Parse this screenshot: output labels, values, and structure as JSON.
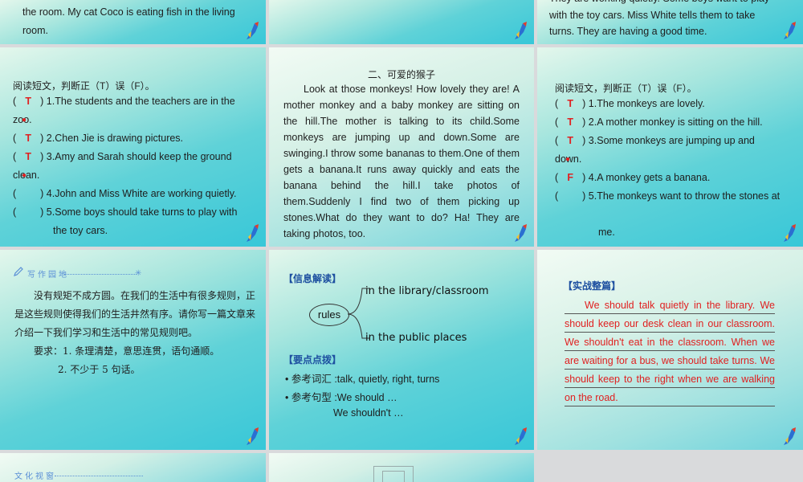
{
  "slide_r1c1": {
    "lines": [
      "the room. My cat Coco is eating fish in the living",
      "room."
    ]
  },
  "slide_r1c3": {
    "lines": [
      "They are working quietly. Some boys want to play",
      "with the toy cars. Miss White tells them to take",
      "turns. They are having a good time."
    ]
  },
  "quiz1": {
    "heading": "阅读短文，判断正（T）误（F）。",
    "items": [
      {
        "answer": "T",
        "text": ") 1.The students and the teachers are in the",
        "cont": "zoo."
      },
      {
        "answer": "T",
        "text": ") 2.Chen Jie is drawing pictures."
      },
      {
        "answer": "T",
        "text": ") 3.Amy and Sarah should keep the ground",
        "cont": "clean."
      },
      {
        "answer": "",
        "text": ") 4.John and Miss White are working quietly."
      },
      {
        "answer": "",
        "text": ") 5.Some boys should take turns to play with",
        "cont": "the toy cars."
      }
    ]
  },
  "passage": {
    "title": "二、可爱的猴子",
    "body": "Look at those monkeys! How lovely they are! A mother monkey and a baby monkey are sitting on the hill.The mother is talking to its child.Some monkeys are jumping up and down.Some are swinging.I throw some bananas to them.One of them gets a banana.It runs away quickly and eats the banana behind the hill.I take photos of them.Suddenly I find two of them picking up stones.What do they want to do? Ha! They are taking photos, too."
  },
  "quiz2": {
    "heading": "阅读短文，判断正（T）误（F）。",
    "items": [
      {
        "answer": "T",
        "text": ") 1.The monkeys are lovely."
      },
      {
        "answer": "T",
        "text": ") 2.A mother monkey is sitting on the hill."
      },
      {
        "answer": "T",
        "text": ") 3.Some monkeys are jumping up and",
        "cont": "down."
      },
      {
        "answer": "F",
        "text": ") 4.A monkey gets a banana."
      },
      {
        "answer": "",
        "text": ") 5.The monkeys want to throw the stones at",
        "cont": "me."
      }
    ]
  },
  "writing": {
    "tag": "写作园地",
    "para1": "没有规矩不成方圆。在我们的生活中有很多规则，正是这些规则使得我们的生活井然有序。请你写一篇文章来介绍一下我们学习和生活中的常见规则吧。",
    "req1": "要求：1. 条理清楚，意思连贯，语句通顺。",
    "req2": "2. 不少于 5 句话。"
  },
  "info": {
    "title1": "【信息解读】",
    "center": "rules",
    "branch_top": "in the library/classroom",
    "branch_bottom": "in the public places",
    "title2": "【要点点拨】",
    "vocab": "• 参考词汇 :talk, quietly, right, turns",
    "pattern": "• 参考句型 :We should …",
    "pattern2": "We shouldn't …"
  },
  "practice": {
    "title": "【实战整篇】",
    "body": "We should talk quietly in the library. We should keep our desk clean in our classroom. We shouldn't eat in the classroom. When we are waiting for a bus, we should take turns. We should keep to the right when we are walking on the road."
  },
  "culture": {
    "tag": "文化视窗"
  },
  "colors": {
    "answer_red": "#e02020",
    "title_blue": "#1d4fa0"
  }
}
